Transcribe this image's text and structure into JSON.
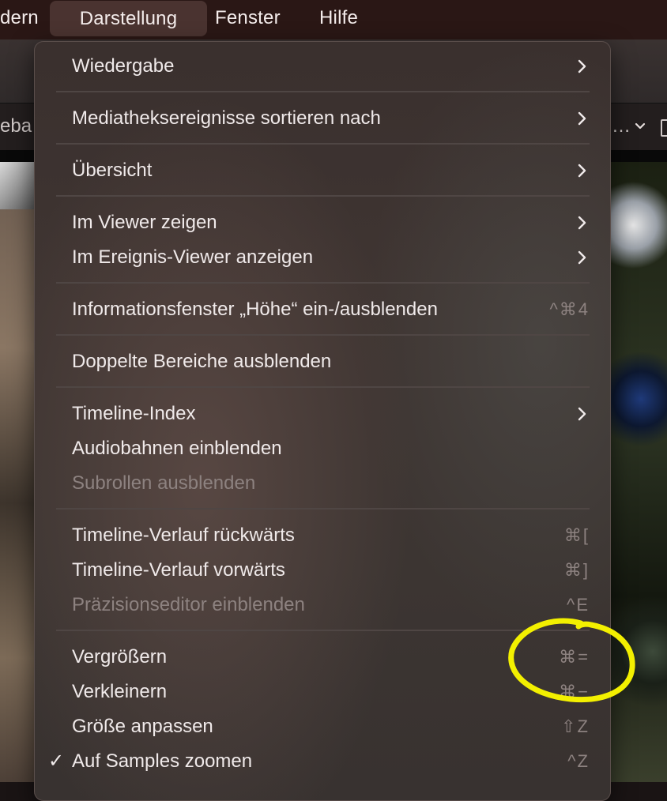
{
  "menubar": {
    "items": [
      {
        "label": "dern"
      },
      {
        "label": "Darstellung"
      },
      {
        "label": "Fenster"
      },
      {
        "label": "Hilfe"
      }
    ]
  },
  "subbar": {
    "left_text": "eba",
    "right_text": "…"
  },
  "menu": {
    "items": [
      {
        "label": "Wiedergabe"
      },
      {
        "label": "Mediatheksereignisse sortieren nach"
      },
      {
        "label": "Übersicht"
      },
      {
        "label": "Im Viewer zeigen"
      },
      {
        "label": "Im Ereignis-Viewer anzeigen"
      },
      {
        "label": "Informationsfenster „Höhe“ ein-/ausblenden",
        "shortcut": "^⌘4"
      },
      {
        "label": "Doppelte Bereiche ausblenden"
      },
      {
        "label": "Timeline-Index"
      },
      {
        "label": "Audiobahnen einblenden"
      },
      {
        "label": "Subrollen ausblenden",
        "disabled": true
      },
      {
        "label": "Timeline-Verlauf rückwärts",
        "shortcut": "⌘["
      },
      {
        "label": "Timeline-Verlauf vorwärts",
        "shortcut": "⌘]"
      },
      {
        "label": "Präzisionseditor einblenden",
        "shortcut": "^E",
        "disabled": true
      },
      {
        "label": "Vergrößern",
        "shortcut": "⌘="
      },
      {
        "label": "Verkleinern",
        "shortcut": "⌘−"
      },
      {
        "label": "Größe anpassen",
        "shortcut": "⇧Z"
      },
      {
        "label": "Auf Samples zoomen",
        "shortcut": "^Z",
        "checked": true,
        "check_mark": "✓"
      }
    ]
  },
  "colors": {
    "annotation_circle": "#f3f000",
    "menu_text": "#f0eaea",
    "menu_text_disabled": "#8d8280"
  }
}
